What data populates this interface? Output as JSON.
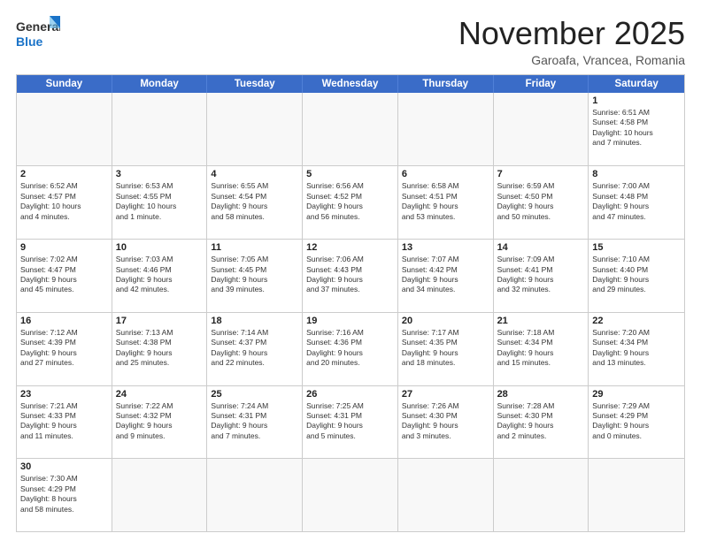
{
  "logo": {
    "general": "General",
    "blue": "Blue"
  },
  "header": {
    "month": "November 2025",
    "location": "Garoafa, Vrancea, Romania"
  },
  "weekdays": [
    "Sunday",
    "Monday",
    "Tuesday",
    "Wednesday",
    "Thursday",
    "Friday",
    "Saturday"
  ],
  "weeks": [
    [
      {
        "day": "",
        "info": ""
      },
      {
        "day": "",
        "info": ""
      },
      {
        "day": "",
        "info": ""
      },
      {
        "day": "",
        "info": ""
      },
      {
        "day": "",
        "info": ""
      },
      {
        "day": "",
        "info": ""
      },
      {
        "day": "1",
        "info": "Sunrise: 6:51 AM\nSunset: 4:58 PM\nDaylight: 10 hours\nand 7 minutes."
      }
    ],
    [
      {
        "day": "2",
        "info": "Sunrise: 6:52 AM\nSunset: 4:57 PM\nDaylight: 10 hours\nand 4 minutes."
      },
      {
        "day": "3",
        "info": "Sunrise: 6:53 AM\nSunset: 4:55 PM\nDaylight: 10 hours\nand 1 minute."
      },
      {
        "day": "4",
        "info": "Sunrise: 6:55 AM\nSunset: 4:54 PM\nDaylight: 9 hours\nand 58 minutes."
      },
      {
        "day": "5",
        "info": "Sunrise: 6:56 AM\nSunset: 4:52 PM\nDaylight: 9 hours\nand 56 minutes."
      },
      {
        "day": "6",
        "info": "Sunrise: 6:58 AM\nSunset: 4:51 PM\nDaylight: 9 hours\nand 53 minutes."
      },
      {
        "day": "7",
        "info": "Sunrise: 6:59 AM\nSunset: 4:50 PM\nDaylight: 9 hours\nand 50 minutes."
      },
      {
        "day": "8",
        "info": "Sunrise: 7:00 AM\nSunset: 4:48 PM\nDaylight: 9 hours\nand 47 minutes."
      }
    ],
    [
      {
        "day": "9",
        "info": "Sunrise: 7:02 AM\nSunset: 4:47 PM\nDaylight: 9 hours\nand 45 minutes."
      },
      {
        "day": "10",
        "info": "Sunrise: 7:03 AM\nSunset: 4:46 PM\nDaylight: 9 hours\nand 42 minutes."
      },
      {
        "day": "11",
        "info": "Sunrise: 7:05 AM\nSunset: 4:45 PM\nDaylight: 9 hours\nand 39 minutes."
      },
      {
        "day": "12",
        "info": "Sunrise: 7:06 AM\nSunset: 4:43 PM\nDaylight: 9 hours\nand 37 minutes."
      },
      {
        "day": "13",
        "info": "Sunrise: 7:07 AM\nSunset: 4:42 PM\nDaylight: 9 hours\nand 34 minutes."
      },
      {
        "day": "14",
        "info": "Sunrise: 7:09 AM\nSunset: 4:41 PM\nDaylight: 9 hours\nand 32 minutes."
      },
      {
        "day": "15",
        "info": "Sunrise: 7:10 AM\nSunset: 4:40 PM\nDaylight: 9 hours\nand 29 minutes."
      }
    ],
    [
      {
        "day": "16",
        "info": "Sunrise: 7:12 AM\nSunset: 4:39 PM\nDaylight: 9 hours\nand 27 minutes."
      },
      {
        "day": "17",
        "info": "Sunrise: 7:13 AM\nSunset: 4:38 PM\nDaylight: 9 hours\nand 25 minutes."
      },
      {
        "day": "18",
        "info": "Sunrise: 7:14 AM\nSunset: 4:37 PM\nDaylight: 9 hours\nand 22 minutes."
      },
      {
        "day": "19",
        "info": "Sunrise: 7:16 AM\nSunset: 4:36 PM\nDaylight: 9 hours\nand 20 minutes."
      },
      {
        "day": "20",
        "info": "Sunrise: 7:17 AM\nSunset: 4:35 PM\nDaylight: 9 hours\nand 18 minutes."
      },
      {
        "day": "21",
        "info": "Sunrise: 7:18 AM\nSunset: 4:34 PM\nDaylight: 9 hours\nand 15 minutes."
      },
      {
        "day": "22",
        "info": "Sunrise: 7:20 AM\nSunset: 4:34 PM\nDaylight: 9 hours\nand 13 minutes."
      }
    ],
    [
      {
        "day": "23",
        "info": "Sunrise: 7:21 AM\nSunset: 4:33 PM\nDaylight: 9 hours\nand 11 minutes."
      },
      {
        "day": "24",
        "info": "Sunrise: 7:22 AM\nSunset: 4:32 PM\nDaylight: 9 hours\nand 9 minutes."
      },
      {
        "day": "25",
        "info": "Sunrise: 7:24 AM\nSunset: 4:31 PM\nDaylight: 9 hours\nand 7 minutes."
      },
      {
        "day": "26",
        "info": "Sunrise: 7:25 AM\nSunset: 4:31 PM\nDaylight: 9 hours\nand 5 minutes."
      },
      {
        "day": "27",
        "info": "Sunrise: 7:26 AM\nSunset: 4:30 PM\nDaylight: 9 hours\nand 3 minutes."
      },
      {
        "day": "28",
        "info": "Sunrise: 7:28 AM\nSunset: 4:30 PM\nDaylight: 9 hours\nand 2 minutes."
      },
      {
        "day": "29",
        "info": "Sunrise: 7:29 AM\nSunset: 4:29 PM\nDaylight: 9 hours\nand 0 minutes."
      }
    ],
    [
      {
        "day": "30",
        "info": "Sunrise: 7:30 AM\nSunset: 4:29 PM\nDaylight: 8 hours\nand 58 minutes."
      },
      {
        "day": "",
        "info": ""
      },
      {
        "day": "",
        "info": ""
      },
      {
        "day": "",
        "info": ""
      },
      {
        "day": "",
        "info": ""
      },
      {
        "day": "",
        "info": ""
      },
      {
        "day": "",
        "info": ""
      }
    ]
  ]
}
